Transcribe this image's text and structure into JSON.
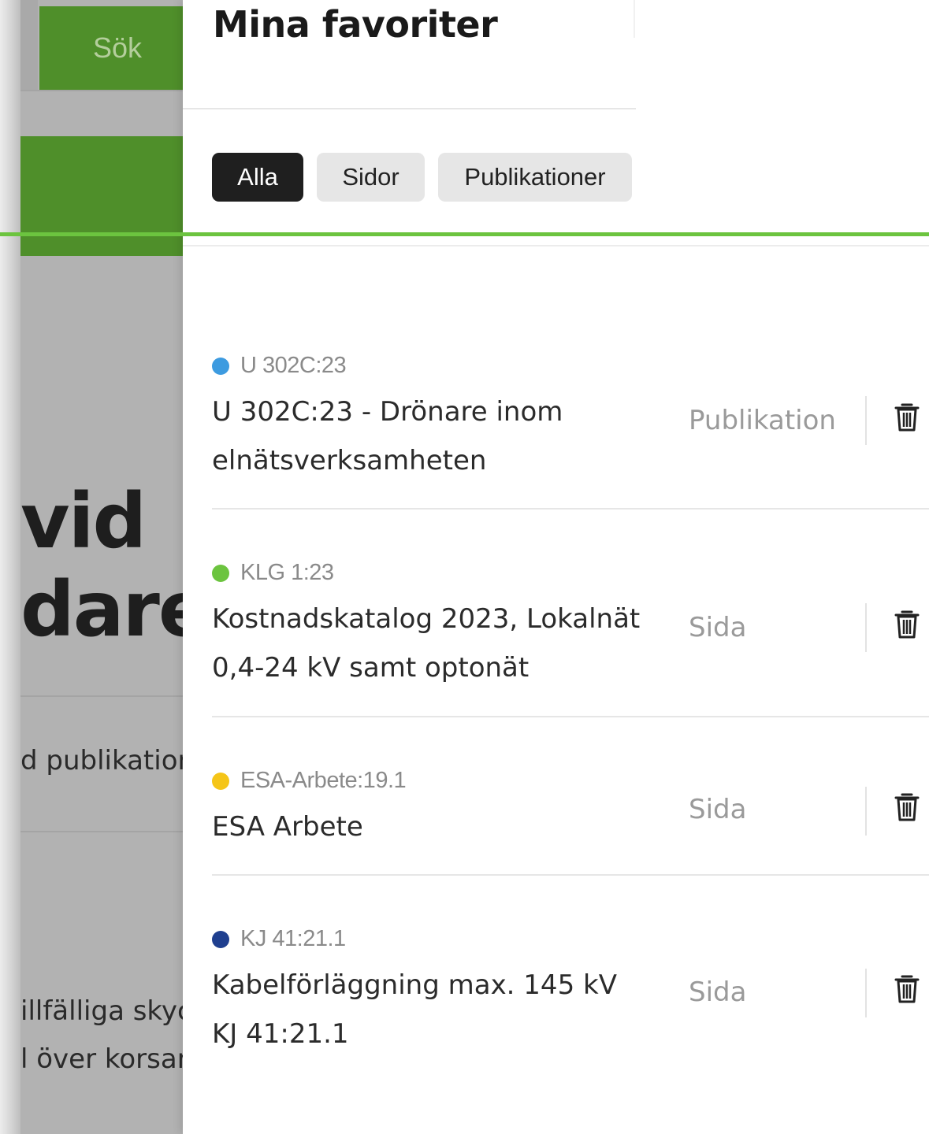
{
  "background": {
    "search_button": "Sök",
    "heading_lines": "vid\ndare",
    "publication_text": "d publikation",
    "line1": "illfälliga skyc",
    "line2": "l över korsar"
  },
  "panel": {
    "title": "Mina favoriter",
    "filters": [
      {
        "label": "Alla",
        "active": true
      },
      {
        "label": "Sidor",
        "active": false
      },
      {
        "label": "Publikationer",
        "active": false
      }
    ],
    "items": [
      {
        "code": "U 302C:23",
        "dot_color": "#3d9be0",
        "title": "U 302C:23 - Drönare inom elnätsverksamheten",
        "type": "Publikation",
        "delete_icon": "trash-icon"
      },
      {
        "code": "KLG 1:23",
        "dot_color": "#6cc43f",
        "title": "Kostnadskatalog 2023, Lokalnät 0,4-24 kV samt optonät",
        "type": "Sida",
        "delete_icon": "trash-icon"
      },
      {
        "code": "ESA-Arbete:19.1",
        "dot_color": "#f5c518",
        "title": "ESA Arbete",
        "type": "Sida",
        "delete_icon": "trash-icon"
      },
      {
        "code": "KJ 41:21.1",
        "dot_color": "#1f3f8f",
        "title": "Kabelförläggning max. 145 kV KJ 41:21.1",
        "type": "Sida",
        "delete_icon": "trash-icon"
      }
    ]
  },
  "colors": {
    "accent_green": "#6cc43f",
    "brand_green": "#4f8f2a",
    "chip_active": "#1f1f1f",
    "chip_inactive": "#e6e6e6"
  }
}
